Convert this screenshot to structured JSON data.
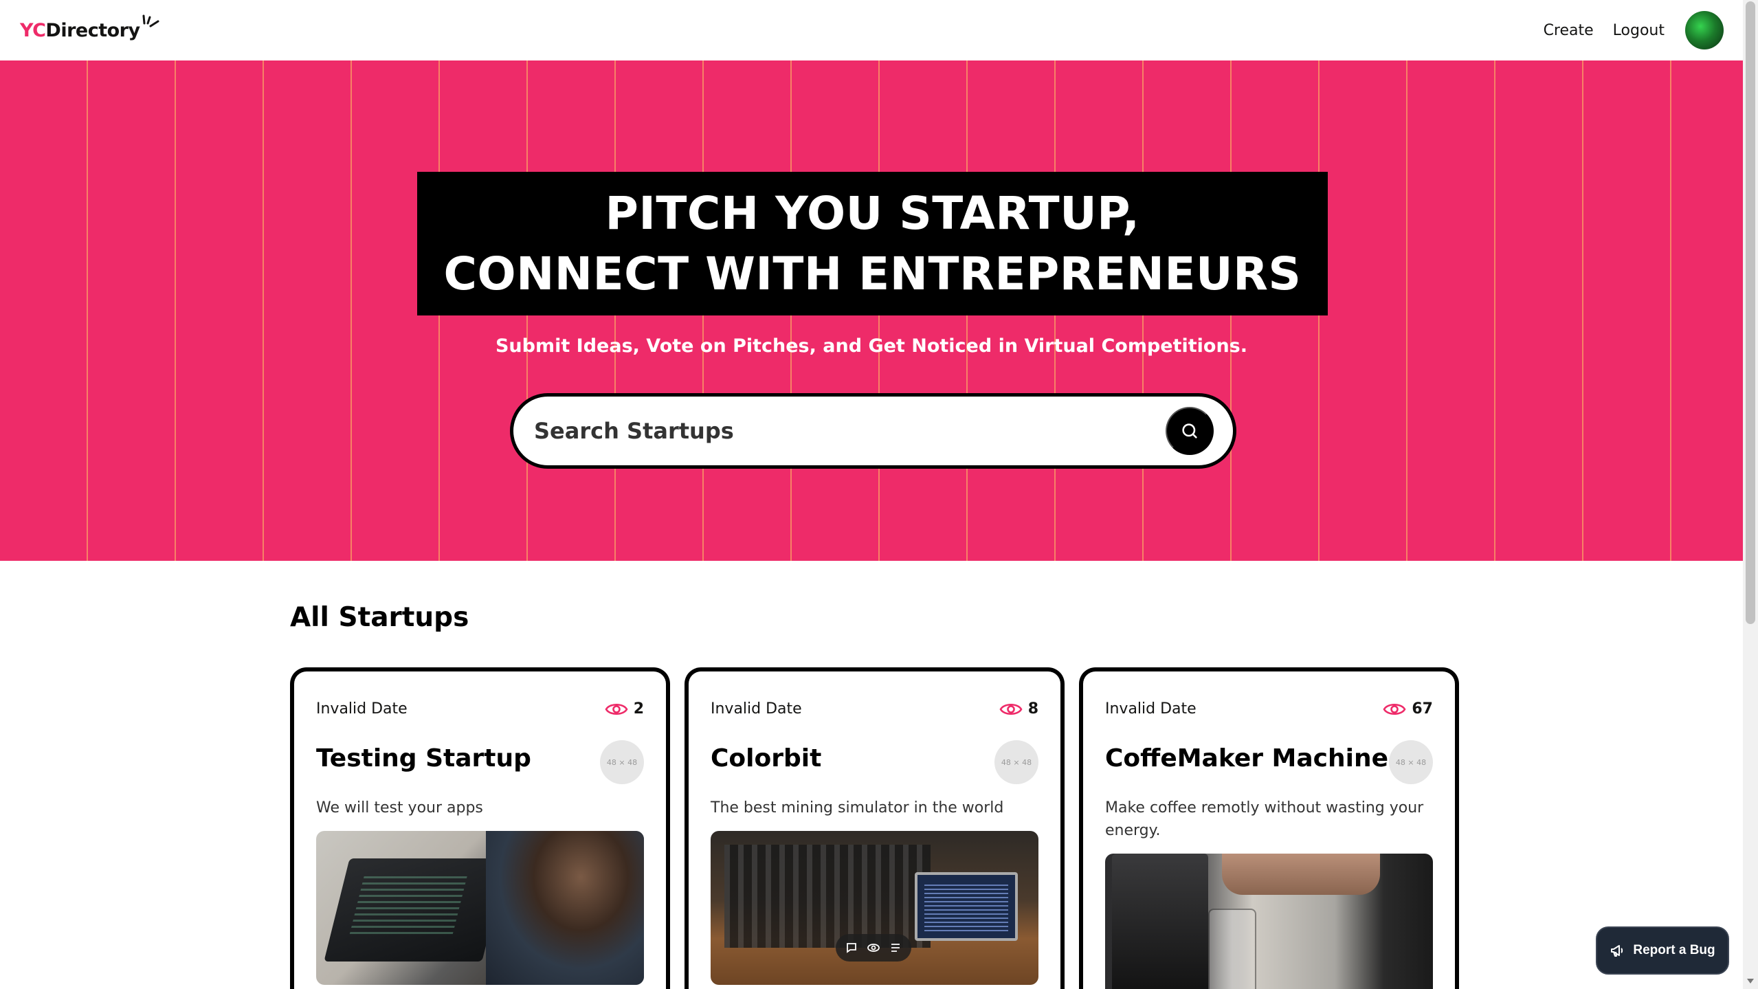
{
  "navbar": {
    "logo_yc": "YC",
    "logo_directory": "Directory",
    "create_label": "Create",
    "logout_label": "Logout"
  },
  "hero": {
    "title_line1": "Pitch you startup,",
    "title_line2": "Connect with entrepreneurs",
    "subtitle": "Submit Ideas, Vote on Pitches, and Get Noticed in Virtual Competitions.",
    "search_placeholder": "Search Startups"
  },
  "startups": {
    "section_title": "All Startups",
    "cards": [
      {
        "date": "Invalid Date",
        "views": "2",
        "title": "Testing Startup",
        "avatar_placeholder": "48 × 48",
        "description": "We will test your apps"
      },
      {
        "date": "Invalid Date",
        "views": "8",
        "title": "Colorbit",
        "avatar_placeholder": "48 × 48",
        "description": "The best mining simulator in the world"
      },
      {
        "date": "Invalid Date",
        "views": "67",
        "title": "CoffeMaker Machine",
        "avatar_placeholder": "48 × 48",
        "description": "Make coffee remotly without wasting your energy."
      }
    ]
  },
  "report_bug_label": "Report a Bug",
  "colors": {
    "primary": "#ee2b69",
    "black": "#000000",
    "bug_button_bg": "#1f2937"
  },
  "icons": {
    "search": "search-icon",
    "views": "eye-icon",
    "report": "megaphone-icon"
  }
}
